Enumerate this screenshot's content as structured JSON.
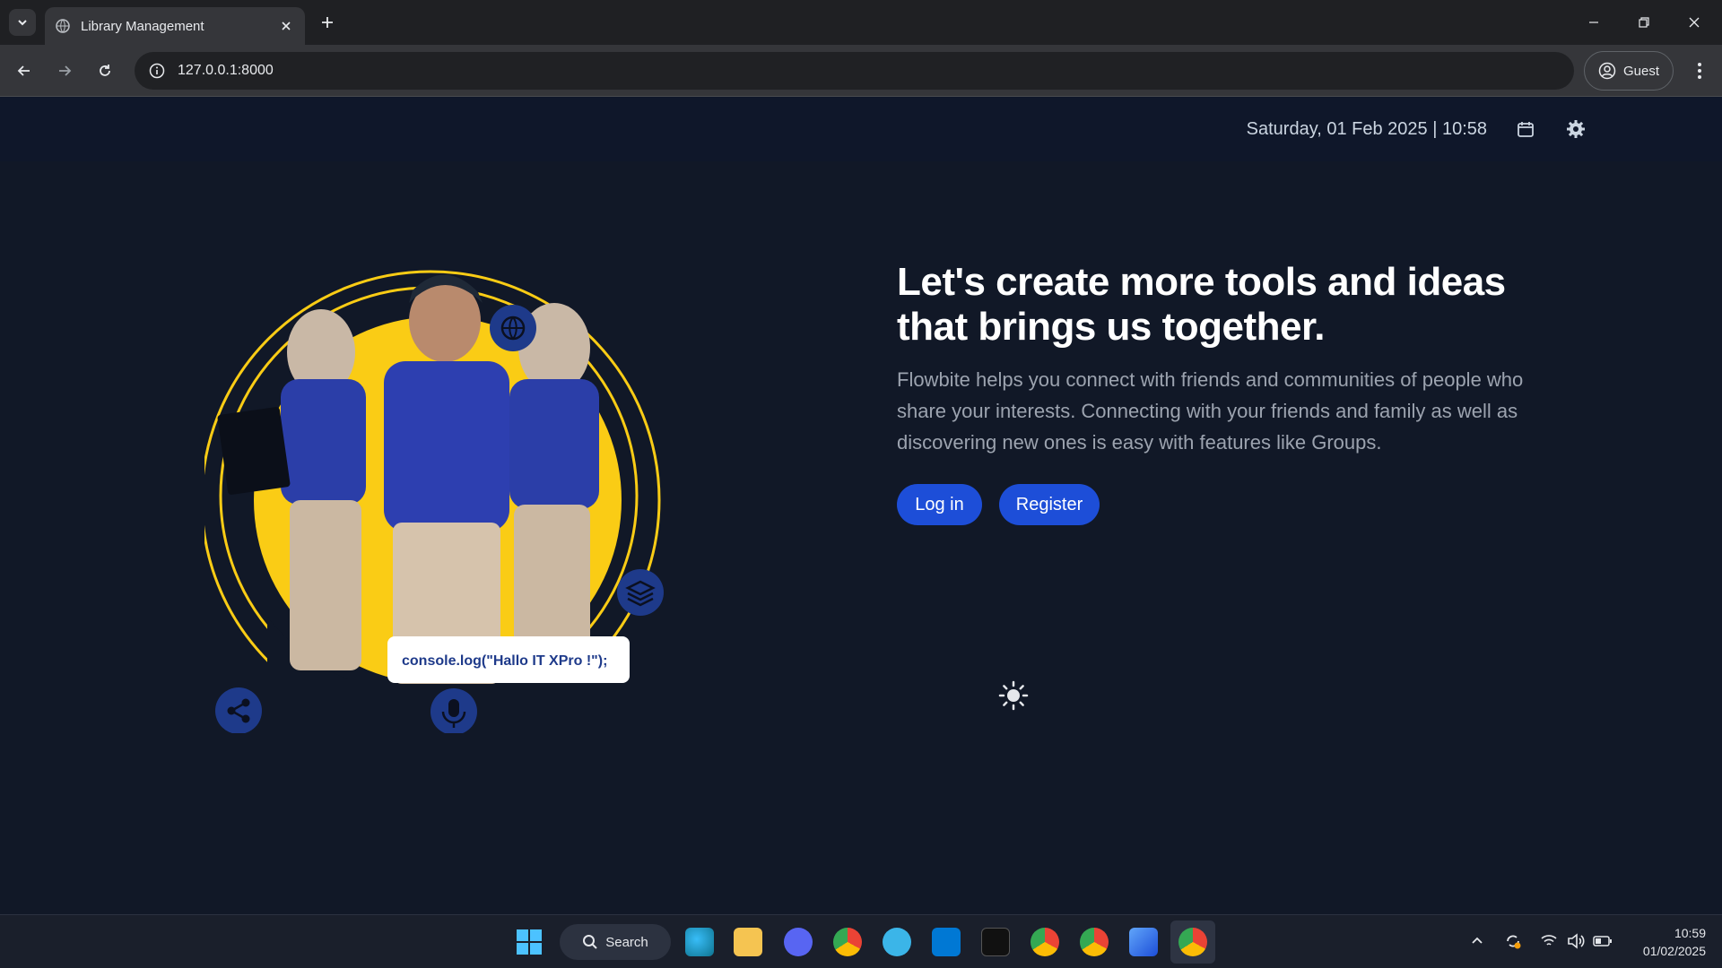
{
  "browser": {
    "tab_title": "Library Management",
    "url": "127.0.0.1:8000",
    "profile_label": "Guest"
  },
  "header": {
    "datetime": "Saturday, 01 Feb 2025 | 10:58"
  },
  "hero": {
    "headline": "Let's create more tools and ideas that brings us together.",
    "description": "Flowbite helps you connect with friends and communities of people who share your interests. Connecting with your friends and family as well as discovering new ones is easy with features like Groups.",
    "login_label": "Log in",
    "register_label": "Register",
    "image_code_text": "console.log(\"Hallo IT XPro !\");"
  },
  "taskbar": {
    "search_label": "Search",
    "time": "10:59",
    "date": "01/02/2025"
  },
  "colors": {
    "page_bg": "#111827",
    "primary_button": "#1d4ed8",
    "accent_yellow": "#facc15",
    "uniform_blue": "#1e3a8a"
  },
  "icons": [
    "globe-icon",
    "close-icon",
    "plus-icon",
    "back-icon",
    "forward-icon",
    "reload-icon",
    "info-icon",
    "profile-icon",
    "more-icon",
    "calendar-icon",
    "gear-icon",
    "sun-icon",
    "windows-icon",
    "search-icon"
  ]
}
